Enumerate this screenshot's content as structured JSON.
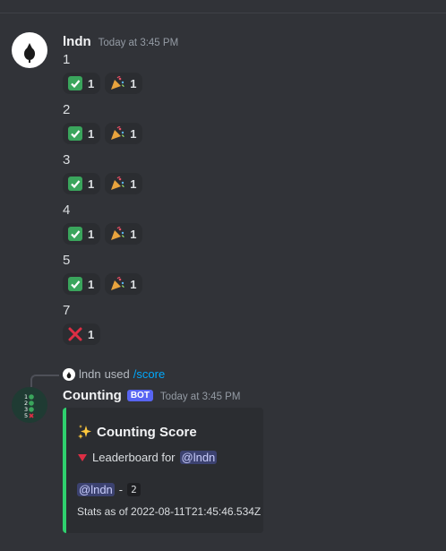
{
  "user_message": {
    "author": "lndn",
    "timestamp": "Today at 3:45 PM",
    "lines": [
      {
        "text": "1",
        "reactions": [
          {
            "emoji": "check-mark-icon",
            "count": "1"
          },
          {
            "emoji": "party-popper-icon",
            "count": "1"
          }
        ]
      },
      {
        "text": "2",
        "reactions": [
          {
            "emoji": "check-mark-icon",
            "count": "1"
          },
          {
            "emoji": "party-popper-icon",
            "count": "1"
          }
        ]
      },
      {
        "text": "3",
        "reactions": [
          {
            "emoji": "check-mark-icon",
            "count": "1"
          },
          {
            "emoji": "party-popper-icon",
            "count": "1"
          }
        ]
      },
      {
        "text": "4",
        "reactions": [
          {
            "emoji": "check-mark-icon",
            "count": "1"
          },
          {
            "emoji": "party-popper-icon",
            "count": "1"
          }
        ]
      },
      {
        "text": "5",
        "reactions": [
          {
            "emoji": "check-mark-icon",
            "count": "1"
          },
          {
            "emoji": "party-popper-icon",
            "count": "1"
          }
        ]
      },
      {
        "text": "7",
        "reactions": [
          {
            "emoji": "cross-mark-icon",
            "count": "1"
          }
        ]
      }
    ]
  },
  "bot_message": {
    "reply_user": "lndn",
    "reply_used": "used",
    "reply_command": "/score",
    "author": "Counting",
    "tag": "BOT",
    "timestamp": "Today at 3:45 PM",
    "embed": {
      "title": "Counting Score",
      "subtitle_prefix": "Leaderboard for",
      "subtitle_mention": "@lndn",
      "entry_mention": "@lndn",
      "entry_separator": "-",
      "entry_score": "2",
      "footer": "Stats as of 2022-08-11T21:45:46.534Z",
      "accent_color": "#2fd06e"
    }
  },
  "colors": {
    "background": "#313338",
    "mention_bg": "#3c4270",
    "command": "#00a8fc",
    "bot_tag": "#5865f2"
  }
}
